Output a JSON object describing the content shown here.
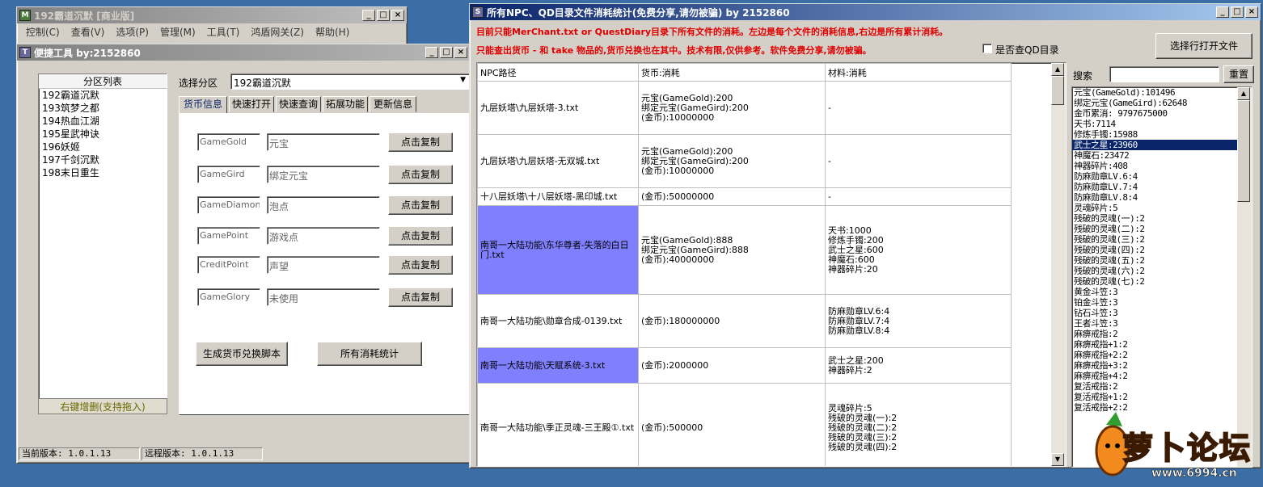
{
  "bg_window": {
    "title": "192霸道沉默 [商业版]",
    "menu": [
      "控制(C)",
      "查看(V)",
      "选项(P)",
      "管理(M)",
      "工具(T)",
      "鸿盾网关(Z)",
      "帮助(H)"
    ]
  },
  "quick_tool": {
    "title": "便捷工具   by:2152860",
    "partition_list_header": "分区列表",
    "partitions": [
      "192霸道沉默",
      "193筑梦之都",
      "194热血江湖",
      "195星武神诀",
      "196妖姬",
      "197千剑沉默",
      "198末日重生"
    ],
    "partition_footer": "右键增删(支持拖入)",
    "select_label": "选择分区",
    "select_value": "192霸道沉默",
    "tabs": [
      "货币信息",
      "快速打开",
      "快速查询",
      "拓展功能",
      "更新信息"
    ],
    "currency_rows": [
      {
        "code": "GameGold",
        "name": "元宝",
        "btn": "点击复制"
      },
      {
        "code": "GameGird",
        "name": "绑定元宝",
        "btn": "点击复制"
      },
      {
        "code": "GameDiamond",
        "name": "泡点",
        "btn": "点击复制"
      },
      {
        "code": "GamePoint",
        "name": "游戏点",
        "btn": "点击复制"
      },
      {
        "code": "CreditPoint",
        "name": "声望",
        "btn": "点击复制"
      },
      {
        "code": "GameGlory",
        "name": "未使用",
        "btn": "点击复制"
      }
    ],
    "gen_script_btn": "生成货币兑换脚本",
    "all_stats_btn": "所有消耗统计",
    "status_current": "当前版本: 1.0.1.13",
    "status_remote": "远程版本: 1.0.1.13"
  },
  "stats_window": {
    "title": "所有NPC、QD目录文件消耗统计(免费分享,请勿被骗)    by 2152860",
    "notice1": "目前只能MerChant.txt or QuestDiary目录下所有文件的消耗。左边是每个文件的消耗信息,右边是所有累计消耗。",
    "notice2": "只能查出货币 - 和 take 物品的,货币兑换也在其中。技术有限,仅供参考。软件免费分享,请勿被骗。",
    "checkbox_label": "是否查QD目录",
    "open_file_btn": "选择行打开文件",
    "search_label": "搜索",
    "reset_btn": "重置",
    "columns": [
      "NPC路径",
      "货币:消耗",
      "材料:消耗"
    ],
    "rows": [
      {
        "path": "九层妖塔\\九层妖塔-3.txt",
        "currency": "元宝(GameGold):200\n绑定元宝(GameGird):200\n(金币):10000000",
        "material": "-",
        "hl": false
      },
      {
        "path": "九层妖塔\\九层妖塔-无双城.txt",
        "currency": "元宝(GameGold):200\n绑定元宝(GameGird):200\n(金币):10000000",
        "material": "-",
        "hl": false
      },
      {
        "path": "十八层妖塔\\十八层妖塔-黑印城.txt",
        "currency": "(金币):50000000",
        "material": "-",
        "hl": false
      },
      {
        "path": "南哥一大陆功能\\东华尊者-失落的白日门.txt",
        "currency": "元宝(GameGold):888\n绑定元宝(GameGird):888\n(金币):40000000",
        "material": "天书:1000\n修炼手镯:200\n武士之星:600\n神魔石:600\n神器碎片:20",
        "hl": true
      },
      {
        "path": "南哥一大陆功能\\勋章合成-0139.txt",
        "currency": "(金币):180000000",
        "material": "防麻勋章LV.6:4\n防麻勋章LV.7:4\n防麻勋章LV.8:4",
        "hl": false
      },
      {
        "path": "南哥一大陆功能\\天赋系统-3.txt",
        "currency": "(金币):2000000",
        "material": "武士之星:200\n神器碎片:2",
        "hl": true
      },
      {
        "path": "南哥一大陆功能\\季正灵魂-三王殿①.txt",
        "currency": "(金币):500000",
        "material": "灵魂碎片:5\n残破的灵魂(一):2\n残破的灵魂(二):2\n残破的灵魂(三):2\n残破的灵魂(四):2",
        "hl": false
      }
    ],
    "totals": [
      "元宝(GameGold):101496",
      "绑定元宝(GameGird):62648",
      "金币累消: 9797675000",
      "天书:7114",
      "修炼手镯:15988",
      "武士之星:23960",
      "神魔石:23472",
      "神器碎片:408",
      "防麻勋章LV.6:4",
      "防麻勋章LV.7:4",
      "防麻勋章LV.8:4",
      "灵魂碎片:5",
      "残破的灵魂(一):2",
      "残破的灵魂(二):2",
      "残破的灵魂(三):2",
      "残破的灵魂(四):2",
      "残破的灵魂(五):2",
      "残破的灵魂(六):2",
      "残破的灵魂(七):2",
      "黄金斗笠:3",
      "铂金斗笠:3",
      "钻石斗笠:3",
      "王者斗笠:3",
      "麻痹戒指:2",
      "麻痹戒指+1:2",
      "麻痹戒指+2:2",
      "麻痹戒指+3:2",
      "麻痹戒指+4:2",
      "复活戒指:2",
      "复活戒指+1:2",
      "复活戒指+2:2"
    ],
    "selected_total_index": 5
  },
  "watermark": {
    "text": "萝卜论坛",
    "url": "www.6994.cn"
  }
}
